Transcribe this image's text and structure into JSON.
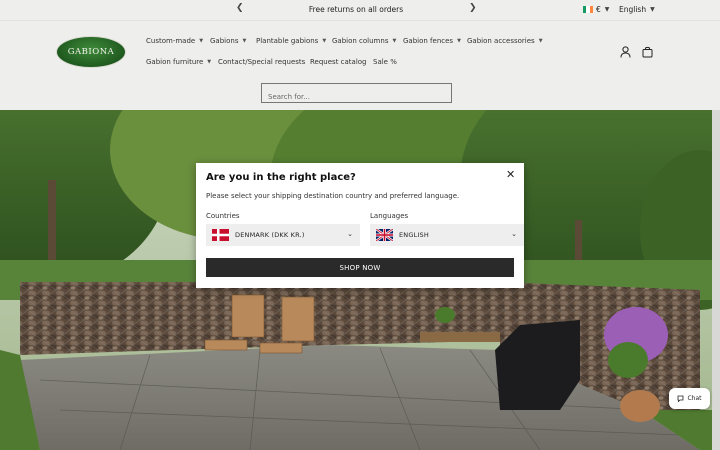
{
  "announcement": {
    "message": "Free returns on all orders",
    "prev_icon": "chevron-left-icon",
    "next_icon": "chevron-right-icon"
  },
  "locale": {
    "currency": "€",
    "language": "English",
    "flag_colors": [
      "#169b62",
      "#ffffff",
      "#ff883e"
    ]
  },
  "header": {
    "logo_text": "GABIONA",
    "nav_row1": [
      {
        "label": "Custom-made",
        "has_dropdown": true
      },
      {
        "label": "Gabions",
        "has_dropdown": true
      },
      {
        "label": "Plantable gabions",
        "has_dropdown": true
      },
      {
        "label": "Gabion columns",
        "has_dropdown": true
      },
      {
        "label": "Gabion fences",
        "has_dropdown": true
      },
      {
        "label": "Gabion accessories",
        "has_dropdown": true
      }
    ],
    "nav_row2": [
      {
        "label": "Gabion furniture",
        "has_dropdown": true
      },
      {
        "label": "Contact/Special requests",
        "has_dropdown": false
      },
      {
        "label": "Request catalog",
        "has_dropdown": false
      },
      {
        "label": "Sale %",
        "has_dropdown": false
      }
    ],
    "account_icon": "user-icon",
    "cart_icon": "cart-icon"
  },
  "search": {
    "placeholder": "Search for..."
  },
  "modal": {
    "title": "Are you in the right place?",
    "subtitle": "Please select your shipping destination country and preferred language.",
    "countries_label": "Countries",
    "country_value": "DENMARK (DKK KR.)",
    "languages_label": "Languages",
    "language_value": "ENGLISH",
    "button_label": "SHOP NOW",
    "close_icon": "close-icon"
  },
  "chat": {
    "label": "Chat"
  },
  "colors": {
    "background": "#eeeeec",
    "button_dark": "#2a2a2a",
    "logo_green": "#1f5a1f"
  }
}
